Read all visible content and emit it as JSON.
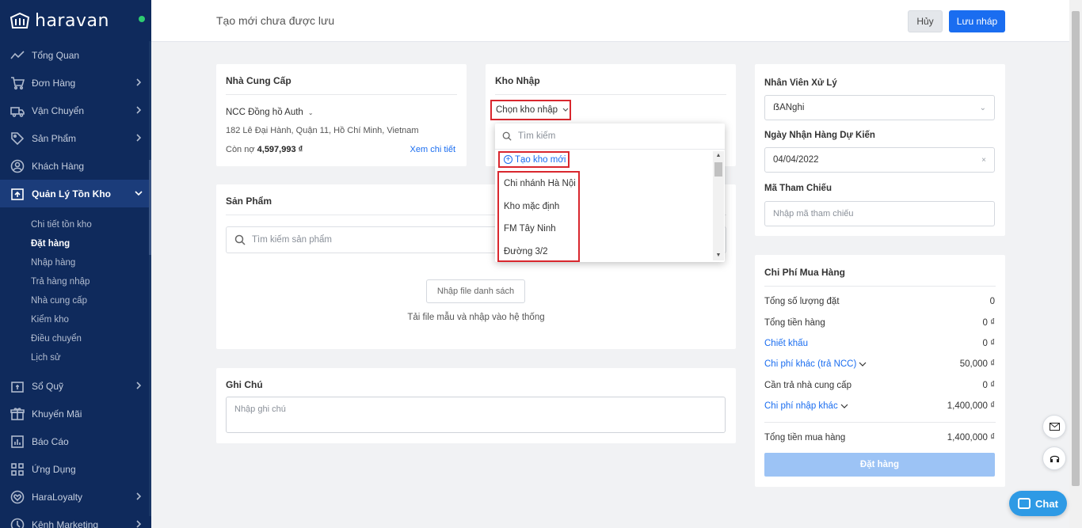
{
  "brand": {
    "name": "haravan",
    "status_color": "#2ecc71",
    "sidebar_bg": "#0f2a5c",
    "accent": "#1a6df0",
    "highlight": "#d9272e"
  },
  "sidebar": {
    "items": [
      {
        "label": "Tổng Quan",
        "icon": "chart-line-icon"
      },
      {
        "label": "Đơn Hàng",
        "icon": "cart-icon"
      },
      {
        "label": "Vận Chuyển",
        "icon": "truck-icon"
      },
      {
        "label": "Sản Phẩm",
        "icon": "tag-icon"
      },
      {
        "label": "Khách Hàng",
        "icon": "user-icon"
      },
      {
        "label": "Quản Lý Tồn Kho",
        "icon": "warehouse-icon"
      },
      {
        "label": "Sổ Quỹ",
        "icon": "wallet-icon"
      },
      {
        "label": "Khuyến Mãi",
        "icon": "gift-icon"
      },
      {
        "label": "Báo Cáo",
        "icon": "report-icon"
      },
      {
        "label": "Ứng Dụng",
        "icon": "apps-icon"
      },
      {
        "label": "HaraLoyalty",
        "icon": "heart-icon"
      },
      {
        "label": "Kênh Marketing",
        "icon": "marketing-icon"
      }
    ],
    "subitems": [
      "Chi tiết tồn kho",
      "Đặt hàng",
      "Nhập hàng",
      "Trả hàng nhập",
      "Nhà cung cấp",
      "Kiểm kho",
      "Điều chuyển",
      "Lịch sử"
    ]
  },
  "topbar": {
    "title": "Tạo mới chưa được lưu",
    "cancel_label": "Hủy",
    "save_label": "Lưu nháp"
  },
  "supplier": {
    "title": "Nhà Cung Cấp",
    "name": "NCC Đồng hồ Auth",
    "address": "182 Lê Đại Hành, Quận 11, Hồ Chí Minh, Vietnam",
    "debt_label": "Còn nợ",
    "debt_value": "4,597,993 ₫",
    "detail_link": "Xem chi tiết"
  },
  "warehouse": {
    "title": "Kho Nhập",
    "select_label": "Chọn kho nhập",
    "search_placeholder": "Tìm kiếm",
    "new_label": "Tạo kho mới",
    "options": [
      "Chi nhánh Hà Nội",
      "Kho mặc định",
      "FM Tây Ninh",
      "Đường 3/2"
    ]
  },
  "products": {
    "title": "Sản Phẩm",
    "search_placeholder": "Tìm kiếm sản phẩm",
    "import_label": "Nhập file danh sách",
    "import_hint": "Tải file mẫu và nhập vào hệ thống"
  },
  "notes": {
    "title": "Ghi Chú",
    "placeholder": "Nhập ghi chú"
  },
  "staff": {
    "staff_label": "Nhân Viên Xử Lý",
    "staff_value": "ẞANghi",
    "date_label": "Ngày Nhận Hàng Dự Kiến",
    "date_value": "04/04/2022",
    "ref_label": "Mã Tham Chiếu",
    "ref_placeholder": "Nhập mã tham chiếu"
  },
  "costs": {
    "title": "Chi Phí Mua Hàng",
    "rows": [
      {
        "label": "Tổng số lượng đặt",
        "value": "0"
      },
      {
        "label": "Tổng tiền hàng",
        "value": "0 ₫"
      },
      {
        "label": "Chiết khấu",
        "value": "0 ₫"
      },
      {
        "label": "Chi phí khác (trả NCC)",
        "value": "50,000 ₫"
      },
      {
        "label": "Cần trả nhà cung cấp",
        "value": "0 ₫"
      },
      {
        "label": "Chi phí nhập khác",
        "value": "1,400,000 ₫"
      }
    ],
    "total_label": "Tổng tiền mua hàng",
    "total_value": "1,400,000 ₫",
    "order_label": "Đặt hàng"
  },
  "chat": {
    "label": "Chat"
  }
}
